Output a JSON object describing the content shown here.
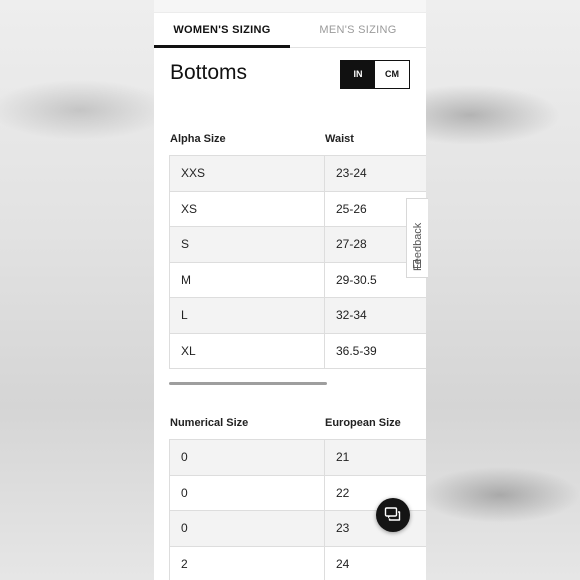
{
  "tabs": [
    {
      "label": "WOMEN'S SIZING",
      "active": true
    },
    {
      "label": "MEN'S SIZING",
      "active": false
    }
  ],
  "section_title": "Bottoms",
  "units": {
    "selected": "IN",
    "options": [
      "IN",
      "CM"
    ]
  },
  "table1": {
    "headers": [
      "Alpha Size",
      "Waist"
    ],
    "rows": [
      [
        "XXS",
        "23-24"
      ],
      [
        "XS",
        "25-26"
      ],
      [
        "S",
        "27-28"
      ],
      [
        "M",
        "29-30.5"
      ],
      [
        "L",
        "32-34"
      ],
      [
        "XL",
        "36.5-39"
      ]
    ]
  },
  "table2": {
    "headers": [
      "Numerical Size",
      "European Size"
    ],
    "rows": [
      [
        "0",
        "21"
      ],
      [
        "0",
        "22"
      ],
      [
        "0",
        "23"
      ],
      [
        "2",
        "24"
      ]
    ]
  },
  "feedback_label": "Feedback",
  "icons": {
    "chat": "chat-bubbles-icon",
    "feedback": "feedback-icon"
  },
  "colors": {
    "accent": "#111111",
    "row_alt": "#f3f3f3",
    "inactive_tab": "#9a9a9a"
  }
}
